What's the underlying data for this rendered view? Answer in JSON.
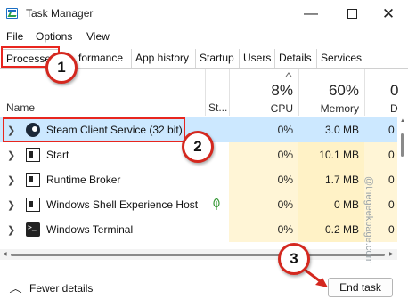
{
  "window": {
    "title": "Task Manager",
    "min_glyph": "—",
    "close_glyph": "✕"
  },
  "menu": [
    "File",
    "Options",
    "View"
  ],
  "tabs": [
    {
      "label": "Processes",
      "active": true
    },
    {
      "label": "Performance",
      "visible_text": "formance"
    },
    {
      "label": "App history"
    },
    {
      "label": "Startup"
    },
    {
      "label": "Users"
    },
    {
      "label": "Details"
    },
    {
      "label": "Services"
    }
  ],
  "columns": {
    "name": "Name",
    "status": "St...",
    "cpu": {
      "percent": "8%",
      "label": "CPU"
    },
    "memory": {
      "percent": "60%",
      "label": "Memory"
    },
    "disk": {
      "percent": "0",
      "label": "D"
    }
  },
  "processes": [
    {
      "name": "Steam Client Service (32 bit)",
      "icon": "steam-icon",
      "cpu": "0%",
      "memory": "3.0 MB",
      "disk": "0",
      "selected": true
    },
    {
      "name": "Start",
      "icon": "window-icon",
      "cpu": "0%",
      "memory": "10.1 MB",
      "disk": "0"
    },
    {
      "name": "Runtime Broker",
      "icon": "window-icon",
      "cpu": "0%",
      "memory": "1.7 MB",
      "disk": "0"
    },
    {
      "name": "Windows Shell Experience Host",
      "icon": "window-icon",
      "cpu": "0%",
      "memory": "0 MB",
      "disk": "0",
      "status_icon": "suspended-leaf-icon"
    },
    {
      "name": "Windows Terminal",
      "icon": "terminal-icon",
      "cpu": "0%",
      "memory": "0.2 MB",
      "disk": "0"
    }
  ],
  "footer": {
    "fewer_details": "Fewer details",
    "end_task": "End task"
  },
  "annotations": {
    "step1": "1",
    "step2": "2",
    "step3": "3",
    "color": "#d4281f"
  },
  "watermark": "@thegeekpage.com",
  "colors": {
    "selected_row": "#cce8ff",
    "heat_cell": "#fff5d6",
    "heat_cell_mem": "#fff2c6",
    "highlight": "#e8261f"
  }
}
